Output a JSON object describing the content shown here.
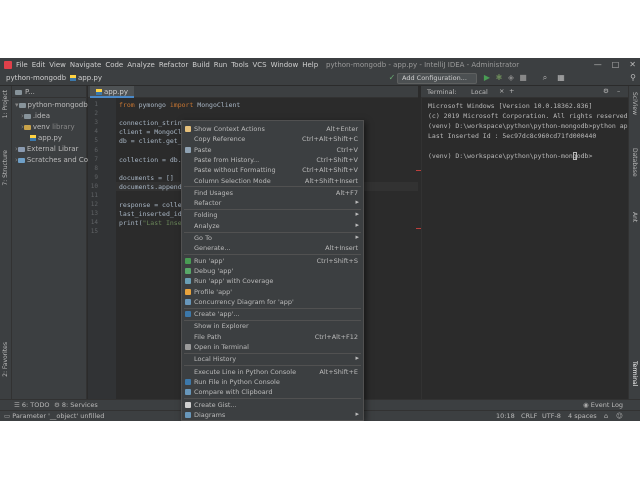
{
  "window": {
    "title": "python-mongodb - app.py - IntelliJ IDEA - Administrator",
    "menu": [
      "File",
      "Edit",
      "View",
      "Navigate",
      "Code",
      "Analyze",
      "Refactor",
      "Build",
      "Run",
      "Tools",
      "VCS",
      "Window",
      "Help"
    ],
    "controls": [
      "—",
      "□",
      "✕"
    ]
  },
  "navbar": {
    "project": "python-mongodb",
    "file": "app.py",
    "add_configuration": "Add Configuration..."
  },
  "left_stripe": [
    "1: Project",
    "7: Structure",
    "2: Favorites"
  ],
  "right_stripe": [
    "SciView",
    "Database",
    "Ant",
    "Terminal"
  ],
  "project_panel": {
    "header": "P...",
    "items": [
      {
        "label": "python-mongodb",
        "kind": "folder"
      },
      {
        "label": ".idea",
        "kind": "folder"
      },
      {
        "label": "venv",
        "kind": "folder",
        "note": "library"
      },
      {
        "label": "app.py",
        "kind": "py"
      },
      {
        "label": "External Librar",
        "kind": "lib"
      },
      {
        "label": "Scratches and Co",
        "kind": "scratch"
      }
    ]
  },
  "editor": {
    "tab": "app.py",
    "line_numbers": [
      "1",
      "2",
      "3",
      "4",
      "5",
      "6",
      "7",
      "8",
      "9",
      "10",
      "11",
      "12",
      "13",
      "14",
      "15"
    ],
    "lines": [
      {
        "n": 1,
        "tokens": [
          {
            "t": "from ",
            "k": "kw"
          },
          {
            "t": "pymongo ",
            "k": "id"
          },
          {
            "t": "import ",
            "k": "kw"
          },
          {
            "t": "MongoClient",
            "k": "id"
          }
        ]
      },
      {
        "n": 3,
        "tokens": [
          {
            "t": "connection_string",
            "k": "id"
          }
        ]
      },
      {
        "n": 4,
        "tokens": [
          {
            "t": "client = MongoCli",
            "k": "id"
          }
        ]
      },
      {
        "n": 5,
        "tokens": [
          {
            "t": "db = client.get_d",
            "k": "id"
          }
        ]
      },
      {
        "n": 7,
        "tokens": [
          {
            "t": "collection = db.g",
            "k": "id"
          }
        ]
      },
      {
        "n": 9,
        "tokens": [
          {
            "t": "documents = []",
            "k": "id"
          }
        ]
      },
      {
        "n": 10,
        "tokens": [
          {
            "t": "documents.append(",
            "k": "id"
          }
        ]
      },
      {
        "n": 12,
        "tokens": [
          {
            "t": "response = collec",
            "k": "id"
          }
        ]
      },
      {
        "n": 13,
        "tokens": [
          {
            "t": "last_inserted_id ",
            "k": "id"
          }
        ]
      },
      {
        "n": 14,
        "tokens": [
          {
            "t": "print(",
            "k": "id"
          },
          {
            "t": "\"Last Inser",
            "k": "str"
          }
        ]
      }
    ]
  },
  "terminal": {
    "label": "Terminal:",
    "tab": "Local",
    "lines": [
      "Microsoft Windows [Version 10.0.18362.836]",
      "(c) 2019 Microsoft Corporation. All rights reserved.",
      "(venv) D:\\workspace\\python\\python-mongodb>python app.py",
      "Last Inserted Id : 5ec97dc8c960cd71fd000440",
      "",
      "(venv) D:\\workspace\\python\\python-mongodb>"
    ]
  },
  "context_menu": {
    "items": [
      {
        "label": "Show Context Actions",
        "shortcut": "Alt+Enter",
        "icon": "bulb-icon"
      },
      {
        "label": "Copy Reference",
        "shortcut": "Ctrl+Alt+Shift+C"
      },
      {
        "label": "Paste",
        "shortcut": "Ctrl+V",
        "icon": "paste-icon"
      },
      {
        "label": "Paste from History...",
        "shortcut": "Ctrl+Shift+V"
      },
      {
        "label": "Paste without Formatting",
        "shortcut": "Ctrl+Alt+Shift+V"
      },
      {
        "label": "Column Selection Mode",
        "shortcut": "Alt+Shift+Insert"
      },
      {
        "sep": true
      },
      {
        "label": "Find Usages",
        "shortcut": "Alt+F7"
      },
      {
        "label": "Refactor",
        "submenu": true
      },
      {
        "sep": true
      },
      {
        "label": "Folding",
        "submenu": true
      },
      {
        "label": "Analyze",
        "submenu": true
      },
      {
        "sep": true
      },
      {
        "label": "Go To",
        "submenu": true
      },
      {
        "label": "Generate...",
        "shortcut": "Alt+Insert"
      },
      {
        "sep": true
      },
      {
        "label": "Run 'app'",
        "shortcut": "Ctrl+Shift+S",
        "icon": "run-icon"
      },
      {
        "label": "Debug 'app'",
        "icon": "debug-icon"
      },
      {
        "label": "Run 'app' with Coverage",
        "icon": "coverage-icon"
      },
      {
        "label": "Profile 'app'",
        "icon": "profile-icon"
      },
      {
        "label": "Concurrency Diagram for 'app'",
        "icon": "concurrency-icon"
      },
      {
        "sep": true
      },
      {
        "label": "Create 'app'...",
        "icon": "python-icon"
      },
      {
        "sep": true
      },
      {
        "label": "Show in Explorer"
      },
      {
        "label": "File Path",
        "shortcut": "Ctrl+Alt+F12"
      },
      {
        "label": "Open in Terminal",
        "icon": "terminal-icon"
      },
      {
        "sep": true
      },
      {
        "label": "Local History",
        "submenu": true
      },
      {
        "sep": true
      },
      {
        "label": "Execute Line in Python Console",
        "shortcut": "Alt+Shift+E"
      },
      {
        "label": "Run File in Python Console",
        "icon": "python-icon"
      },
      {
        "label": "Compare with Clipboard",
        "icon": "compare-icon"
      },
      {
        "sep": true
      },
      {
        "label": "Create Gist...",
        "icon": "github-icon"
      },
      {
        "label": "Diagrams",
        "submenu": true,
        "icon": "diagram-icon"
      }
    ]
  },
  "bottom_tools": {
    "todo": "6: TODO",
    "services": "8: Services",
    "event_log": "Event Log"
  },
  "status": {
    "message": "Parameter '__object' unfilled",
    "position": "10:18",
    "line_sep": "CRLF",
    "encoding": "UTF-8",
    "indent": "4 spaces"
  },
  "colors": {
    "background": "#2b2b2b",
    "panel": "#3c3f41",
    "keyword": "#cc7832",
    "string": "#6a8759",
    "text": "#a9b7c6"
  }
}
